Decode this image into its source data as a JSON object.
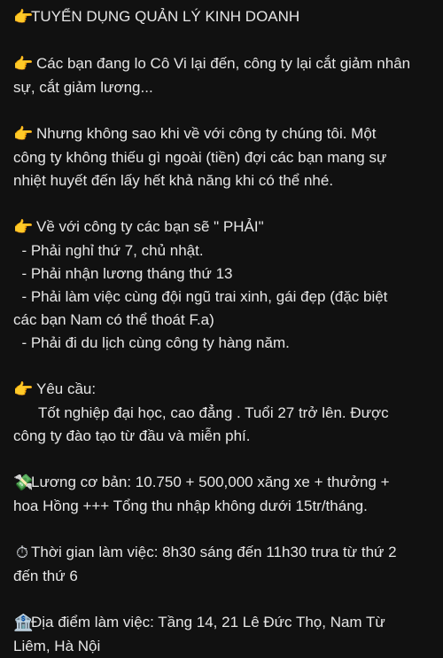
{
  "post": {
    "title": "TUYỂN DỤNG QUẢN LÝ KINH DOANH",
    "intro": [
      "Các bạn đang lo Cô Vi lại đến, công ty lại cắt giảm nhân",
      "sự, cắt giảm lương..."
    ],
    "pitch": [
      "Nhưng không sao khi về với công ty chúng tôi. Một",
      "công ty không thiếu gì ngoài (tiền) đợi các bạn mang sự",
      "nhiệt huyết đến lấy hết khả năng khi có thể nhé."
    ],
    "must_heading": "Về với công ty các bạn sẽ \" PHẢI\"",
    "must_items": [
      "  - Phải nghỉ thứ 7, chủ nhật.",
      "  - Phải nhận lương tháng thứ 13",
      "  - Phải làm việc cùng đội ngũ trai xinh, gái đẹp (đặc biệt",
      "các bạn Nam có thể thoát F.a)",
      "  - Phải đi du lịch cùng công ty hàng năm."
    ],
    "requirements_heading": "Yêu cầu:",
    "requirements": [
      "      Tốt nghiệp đại học, cao đẳng . Tuổi 27 trở lên. Được",
      "công ty đào tạo từ đầu và miễn phí."
    ],
    "salary": [
      "Lương cơ bản: 10.750 + 500,000 xăng xe + thưởng +",
      "hoa Hồng +++ Tổng thu nhập không dưới 15tr/tháng."
    ],
    "hours": [
      "Thời gian làm việc: 8h30 sáng đến 11h30 trưa từ thứ 2",
      "đến thứ 6"
    ],
    "location": [
      "Địa điểm làm việc: Tầng 14, 21 Lê Đức Thọ, Nam Từ",
      "Liêm, Hà Nội"
    ]
  },
  "icons": {
    "pointing_hand": "👉",
    "money": "💸",
    "stopwatch": "⏱",
    "bank": "🏦"
  },
  "colors": {
    "background": "#111111",
    "text": "#e6e6e6"
  }
}
